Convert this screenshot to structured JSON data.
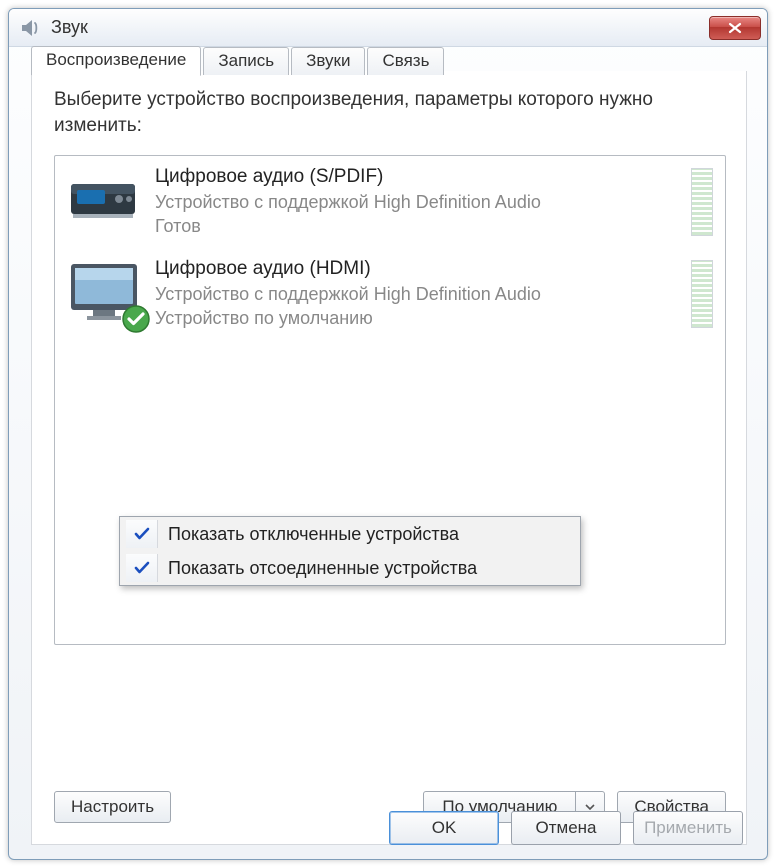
{
  "window": {
    "title": "Звук"
  },
  "tabs": [
    {
      "label": "Воспроизведение",
      "active": true
    },
    {
      "label": "Запись",
      "active": false
    },
    {
      "label": "Звуки",
      "active": false
    },
    {
      "label": "Связь",
      "active": false
    }
  ],
  "instruction": "Выберите устройство воспроизведения, параметры которого нужно изменить:",
  "devices": [
    {
      "name": "Цифровое аудио (S/PDIF)",
      "description": "Устройство с поддержкой High Definition Audio",
      "status": "Готов",
      "icon": "spdif-receiver-icon",
      "is_default": false
    },
    {
      "name": "Цифровое аудио (HDMI)",
      "description": "Устройство с поддержкой High Definition Audio",
      "status": "Устройство по умолчанию",
      "icon": "hdmi-monitor-icon",
      "is_default": true
    }
  ],
  "context_menu": {
    "items": [
      {
        "label": "Показать отключенные устройства",
        "checked": true
      },
      {
        "label": "Показать отсоединенные устройства",
        "checked": true
      }
    ]
  },
  "footer": {
    "configure": "Настроить",
    "set_default": "По умолчанию",
    "properties": "Свойства"
  },
  "dialog_buttons": {
    "ok": "OK",
    "cancel": "Отмена",
    "apply": "Применить"
  }
}
